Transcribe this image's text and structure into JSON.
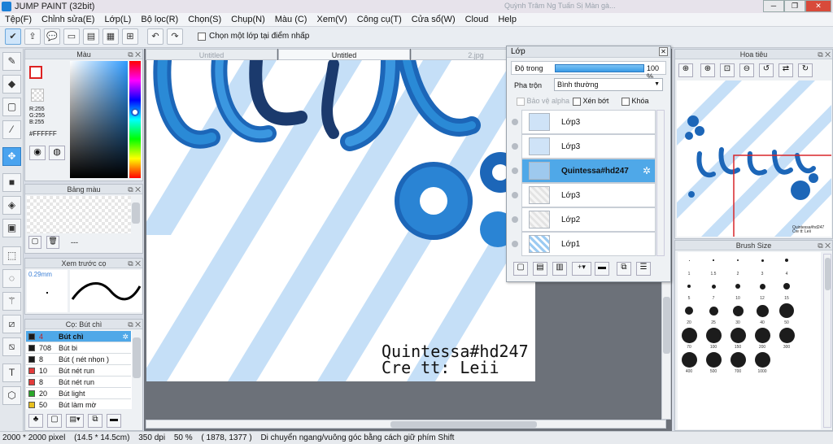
{
  "app": {
    "title": "JUMP PAINT (32bit)",
    "ghost_title": "Quỳnh Trâm Ng Tuấn Sị Màn gà..."
  },
  "menu": [
    "Tệp(F)",
    "Chỉnh sửa(E)",
    "Lớp(L)",
    "Bộ lọc(R)",
    "Chọn(S)",
    "Chụp(N)",
    "Màu (C)",
    "Xem(V)",
    "Công cụ(T)",
    "Cửa sổ(W)",
    "Cloud",
    "Help"
  ],
  "toolbar": {
    "first_layer_label": "Chọn một lớp tại điểm nhấp"
  },
  "color_panel": {
    "title": "Màu",
    "r": "R:255",
    "g": "G:255",
    "b": "B:255",
    "hex": "#FFFFFF"
  },
  "palette_panel": {
    "title": "Bảng màu",
    "dash": "---"
  },
  "preview_panel": {
    "title": "Xem trước cọ",
    "size": "0.29mm"
  },
  "brush_list": {
    "title": "Cọ: Bút chì",
    "items": [
      {
        "size": "4",
        "name": "Bút chì",
        "color": "#1a1a1a"
      },
      {
        "size": "708",
        "name": "Bút bi",
        "color": "#1a1a1a"
      },
      {
        "size": "8",
        "name": "Bút ( nét nhọn )",
        "color": "#1a1a1a"
      },
      {
        "size": "10",
        "name": "Bút nét run",
        "color": "#e23b3b"
      },
      {
        "size": "8",
        "name": "Bút nét run",
        "color": "#e23b3b"
      },
      {
        "size": "20",
        "name": "Bút light",
        "color": "#2aa82a"
      },
      {
        "size": "50",
        "name": "Bút làm mờ",
        "color": "#e8c020"
      }
    ]
  },
  "doc_tabs": [
    "Untitled",
    "Untitled",
    "2.jpg"
  ],
  "canvas": {
    "line1": "Quintessa#hd247",
    "line2": "Cre tt: Leii"
  },
  "layer_window": {
    "title": "Lớp",
    "opacity_label": "Độ trong",
    "opacity_value": "100 %",
    "blend_label": "Pha trộn",
    "blend_value": "Bình thường",
    "protect_alpha": "Bảo vệ alpha",
    "clip": "Xén bớt",
    "lock": "Khóa",
    "layers": [
      "Lớp3",
      "Lớp3",
      "Quintessa#hd247",
      "Lớp3",
      "Lớp2",
      "Lớp1"
    ]
  },
  "navigator": {
    "title": "Hoa tiêu"
  },
  "brush_size": {
    "title": "Brush Size",
    "sizes": [
      "1",
      "1.5",
      "2",
      "3",
      "4",
      "5",
      "7",
      "10",
      "12",
      "15",
      "20",
      "25",
      "30",
      "40",
      "50",
      "70",
      "100",
      "150",
      "200",
      "300",
      "400",
      "500",
      "700",
      "1000"
    ]
  },
  "status": {
    "dims": "2000 * 2000 pixel",
    "mm": "(14.5 * 14.5cm)",
    "dpi": "350 dpi",
    "zoom": "50 %",
    "coords": "( 1878, 1377 )",
    "hint": "Di chuyển ngang/vuông góc bằng cách giữ phím Shift"
  },
  "colors": {
    "accent": "#4fa8e8",
    "selection": "#2c7fc9",
    "art_blue": "#1a6fc0",
    "art_light": "#bfdcf5"
  }
}
